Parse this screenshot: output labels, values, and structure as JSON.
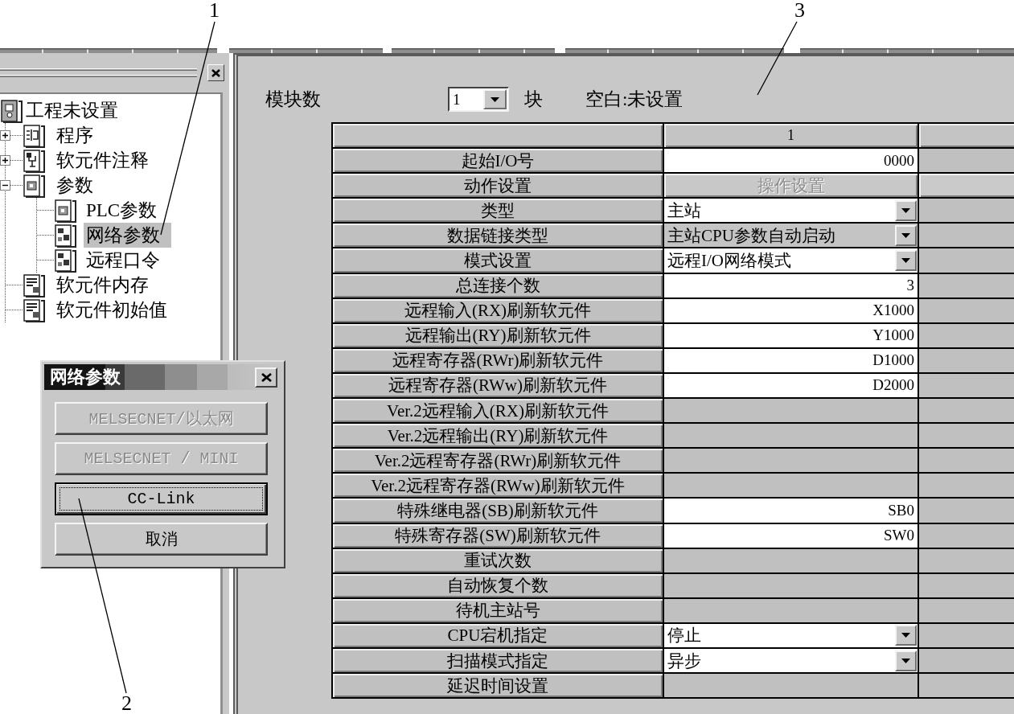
{
  "callouts": [
    {
      "label": "1",
      "kind": "tree"
    },
    {
      "label": "2",
      "kind": "button"
    },
    {
      "label": "3",
      "kind": "panel"
    }
  ],
  "project_tree": {
    "items": [
      {
        "label": "工程未设置",
        "kind": "project",
        "selected": false,
        "children": [
          {
            "label": "程序",
            "kind": "program",
            "expanded": false,
            "selected": false
          },
          {
            "label": "软元件注释",
            "kind": "comment",
            "expanded": false,
            "selected": false
          },
          {
            "label": "参数",
            "kind": "parameter",
            "expanded": true,
            "selected": false,
            "children": [
              {
                "label": "PLC参数",
                "kind": "parameter",
                "selected": false
              },
              {
                "label": "网络参数",
                "kind": "network",
                "selected": true
              },
              {
                "label": "远程口令",
                "kind": "network",
                "selected": false
              }
            ]
          },
          {
            "label": "软元件内存",
            "kind": "memory",
            "selected": false
          },
          {
            "label": "软元件初始值",
            "kind": "memory",
            "selected": false
          }
        ]
      }
    ]
  },
  "dialog": {
    "title": "网络参数",
    "buttons": [
      {
        "label": "MELSECNET/以太网",
        "disabled": true,
        "focused": false
      },
      {
        "label": "MELSECNET / MINI",
        "disabled": true,
        "focused": false
      },
      {
        "label": "CC-Link",
        "disabled": false,
        "focused": true
      },
      {
        "label": "取消",
        "disabled": false,
        "focused": false
      }
    ]
  },
  "module_count": {
    "label": "模块数",
    "value": "1",
    "unit": "块",
    "note": "空白:未设置"
  },
  "table": {
    "columns": [
      {
        "label": "1"
      }
    ],
    "rows": [
      {
        "label": "起始I/O号",
        "kind": "text",
        "value": "0000"
      },
      {
        "label": "动作设置",
        "kind": "button",
        "value": "操作设置",
        "disabled": true
      },
      {
        "label": "类型",
        "kind": "select",
        "value": "主站",
        "disabled": false
      },
      {
        "label": "数据链接类型",
        "kind": "select",
        "value": "主站CPU参数自动启动",
        "disabled": true
      },
      {
        "label": "模式设置",
        "kind": "select",
        "value": "远程I/O网络模式",
        "disabled": false
      },
      {
        "label": "总连接个数",
        "kind": "text",
        "value": "3"
      },
      {
        "label": "远程输入(RX)刷新软元件",
        "kind": "text",
        "value": "X1000"
      },
      {
        "label": "远程输出(RY)刷新软元件",
        "kind": "text",
        "value": "Y1000"
      },
      {
        "label": "远程寄存器(RWr)刷新软元件",
        "kind": "text",
        "value": "D1000"
      },
      {
        "label": "远程寄存器(RWw)刷新软元件",
        "kind": "text",
        "value": "D2000"
      },
      {
        "label": "Ver.2远程输入(RX)刷新软元件",
        "kind": "blank"
      },
      {
        "label": "Ver.2远程输出(RY)刷新软元件",
        "kind": "blank"
      },
      {
        "label": "Ver.2远程寄存器(RWr)刷新软元件",
        "kind": "blank"
      },
      {
        "label": "Ver.2远程寄存器(RWw)刷新软元件",
        "kind": "blank"
      },
      {
        "label": "特殊继电器(SB)刷新软元件",
        "kind": "text",
        "value": "SB0"
      },
      {
        "label": "特殊寄存器(SW)刷新软元件",
        "kind": "text",
        "value": "SW0"
      },
      {
        "label": "重试次数",
        "kind": "blank"
      },
      {
        "label": "自动恢复个数",
        "kind": "blank"
      },
      {
        "label": "待机主站号",
        "kind": "blank"
      },
      {
        "label": "CPU宕机指定",
        "kind": "select",
        "value": "停止",
        "disabled": false
      },
      {
        "label": "扫描模式指定",
        "kind": "select",
        "value": "异步",
        "disabled": false
      },
      {
        "label": "延迟时间设置",
        "kind": "blank"
      }
    ]
  }
}
